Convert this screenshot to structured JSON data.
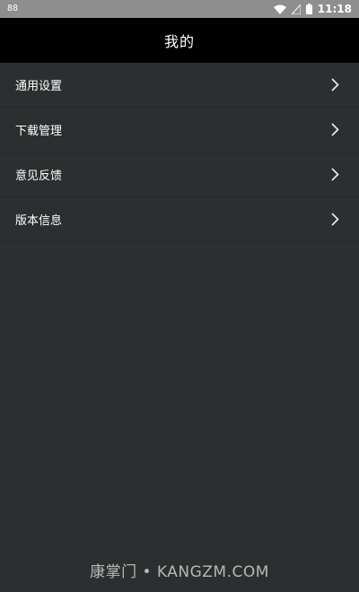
{
  "status_bar": {
    "left_text": "88",
    "time": "11:18",
    "icons": [
      "wifi-icon",
      "signal-off-icon",
      "battery-icon"
    ]
  },
  "header": {
    "title": "我的"
  },
  "menu": {
    "items": [
      {
        "label": "通用设置",
        "icon": "chevron-right-icon"
      },
      {
        "label": "下载管理",
        "icon": "chevron-right-icon"
      },
      {
        "label": "意见反馈",
        "icon": "chevron-right-icon"
      },
      {
        "label": "版本信息",
        "icon": "chevron-right-icon"
      }
    ]
  },
  "watermark": {
    "text": "康掌门 • KANGZM.COM"
  },
  "colors": {
    "background": "#2b2f30",
    "title_bar": "#000000",
    "status_bar": "#8e8e8e",
    "text": "#ffffff",
    "divider": "#252829"
  }
}
